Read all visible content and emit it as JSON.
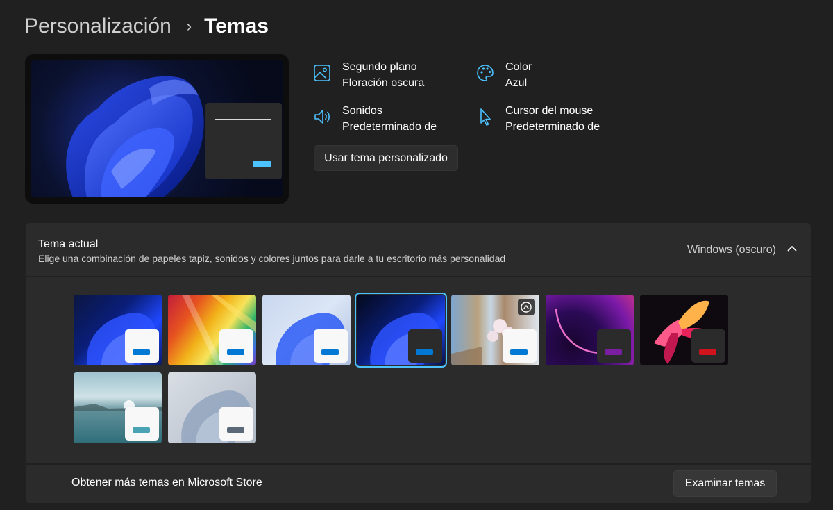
{
  "breadcrumb": {
    "parent": "Personalización",
    "separator": "›",
    "current": "Temas"
  },
  "properties": {
    "background": {
      "label": "Segundo plano",
      "value": "Floración oscura",
      "icon": "image-icon"
    },
    "color": {
      "label": "Color",
      "value": "Azul",
      "icon": "palette-icon"
    },
    "sounds": {
      "label": "Sonidos",
      "value": "Predeterminado de",
      "icon": "speaker-icon"
    },
    "cursor": {
      "label": "Cursor del mouse",
      "value": "Predeterminado de",
      "icon": "cursor-icon"
    }
  },
  "custom_button": "Usar tema personalizado",
  "current_theme": {
    "title": "Tema actual",
    "subtitle": "Elige una combinación de papeles tapiz, sonidos y colores juntos para darle a tu escritorio más personalidad",
    "value": "Windows (oscuro)",
    "expanded": true
  },
  "themes": [
    {
      "id": "windows-light",
      "bg": "blue-bloom",
      "mini_bg": "#f8f8f8",
      "bar": "#0078d4"
    },
    {
      "id": "glow",
      "bg": "rainbow",
      "mini_bg": "#f8f8f8",
      "bar": "#0078d4"
    },
    {
      "id": "windows-light-bloom",
      "bg": "light-bloom",
      "mini_bg": "#f8f8f8",
      "bar": "#0078d4"
    },
    {
      "id": "windows-dark",
      "bg": "blue-bloom",
      "mini_bg": "#2b2b2b",
      "bar": "#0078d4",
      "selected": true
    },
    {
      "id": "spotlight",
      "bg": "cherry",
      "mini_bg": "#f8f8f8",
      "bar": "#0078d4",
      "badge": "spotlight-badge-icon"
    },
    {
      "id": "captured-motion",
      "bg": "purple",
      "mini_bg": "#2b2b2b",
      "bar": "#7a1fa2"
    },
    {
      "id": "flow",
      "bg": "flower",
      "mini_bg": "#2b2b2b",
      "bar": "#d1131e"
    },
    {
      "id": "sunrise",
      "bg": "lake",
      "mini_bg": "#f8f8f8",
      "bar": "#4aa3b4"
    },
    {
      "id": "glacier",
      "bg": "pale-bloom",
      "mini_bg": "#f8f8f8",
      "bar": "#5a6878"
    }
  ],
  "footer": {
    "text": "Obtener más temas en Microsoft Store",
    "button": "Examinar temas"
  },
  "colors": {
    "accent": "#4cc2ff",
    "panel": "#2b2b2b",
    "page": "#202020"
  }
}
